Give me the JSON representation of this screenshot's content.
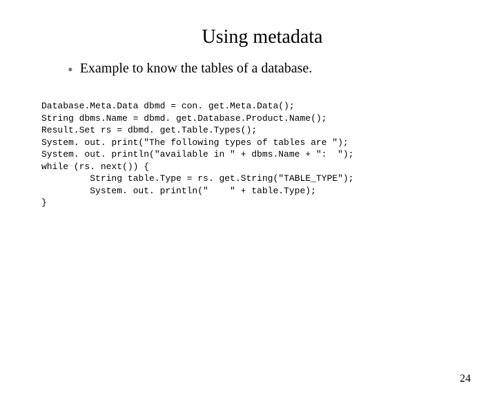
{
  "title": "Using metadata",
  "bullet": "Example to know the tables of a database.",
  "code": "Database.Meta.Data dbmd = con. get.Meta.Data();\nString dbms.Name = dbmd. get.Database.Product.Name();\nResult.Set rs = dbmd. get.Table.Types();\nSystem. out. print(\"The following types of tables are \");\nSystem. out. println(\"available in \" + dbms.Name + \":  \");\nwhile (rs. next()) {\n         String table.Type = rs. get.String(\"TABLE_TYPE\");\n         System. out. println(\"    \" + table.Type);\n}",
  "page_number": "24"
}
